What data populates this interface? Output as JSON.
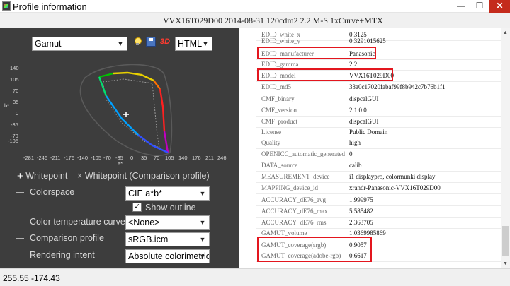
{
  "window": {
    "title": "Profile information",
    "minimize": "—",
    "maximize": "☐",
    "close": "✕"
  },
  "header": {
    "profile_title": "VVX16T029D00 2014-08-31 120cdm2 2.2 M-S 1xCurve+MTX"
  },
  "toolbar": {
    "view_select": "Gamut",
    "format_select": "HTML",
    "threed_label": "3D"
  },
  "plot": {
    "y_axis_label": "b*",
    "x_axis_label": "a*",
    "y_ticks": [
      "140",
      "105",
      "70",
      "35",
      "0",
      "-35",
      "-70",
      "-105"
    ],
    "x_ticks": [
      "-281",
      "-246",
      "-211",
      "-176",
      "-140",
      "-105",
      "-70",
      "-35",
      "0",
      "35",
      "70",
      "105",
      "140",
      "176",
      "211",
      "246"
    ]
  },
  "legend": {
    "plus_glyph": "+",
    "whitepoint": "Whitepoint",
    "x_glyph": "×",
    "whitepoint_comparison": "Whitepoint (Comparison profile)"
  },
  "settings": {
    "colorspace_label": "Colorspace",
    "colorspace_value": "CIE a*b*",
    "show_outline_label": "Show outline",
    "show_outline_checked": true,
    "check_mark": "✓",
    "color_temp_label": "Color temperature curve",
    "color_temp_value": "<None>",
    "comparison_label": "Comparison profile",
    "comparison_value": "sRGB.icm",
    "intent_label": "Rendering intent",
    "intent_value": "Absolute colorimetric"
  },
  "table": {
    "rows": [
      {
        "key": "EDID_white_x",
        "value": "0.3125"
      },
      {
        "key": "EDID_white_y",
        "value": "0.3291015625"
      },
      {
        "key": "EDID_manufacturer",
        "value": "Panasonic"
      },
      {
        "key": "EDID_gamma",
        "value": "2.2"
      },
      {
        "key": "EDID_model",
        "value": "VVX16T029D00"
      },
      {
        "key": "EDID_md5",
        "value": "33a0c17020fabaf99f8b942c7b76b1f1"
      },
      {
        "key": "CMF_binary",
        "value": "dispcalGUI"
      },
      {
        "key": "CMF_version",
        "value": "2.1.0.0"
      },
      {
        "key": "CMF_product",
        "value": "dispcalGUI"
      },
      {
        "key": "License",
        "value": "Public Domain"
      },
      {
        "key": "Quality",
        "value": "high"
      },
      {
        "key": "OPENICC_automatic_generated",
        "value": "0"
      },
      {
        "key": "DATA_source",
        "value": "calib"
      },
      {
        "key": "MEASUREMENT_device",
        "value": "i1 displaypro, colormunki display"
      },
      {
        "key": "MAPPING_device_id",
        "value": "xrandr-Panasonic-VVX16T029D00"
      },
      {
        "key": "ACCURACY_dE76_avg",
        "value": "1.999975"
      },
      {
        "key": "ACCURACY_dE76_max",
        "value": "5.585482"
      },
      {
        "key": "ACCURACY_dE76_rms",
        "value": "2.363705"
      },
      {
        "key": "GAMUT_volume",
        "value": "1.0369985869"
      },
      {
        "key": "GAMUT_coverage(srgb)",
        "value": "0.9057"
      },
      {
        "key": "GAMUT_coverage(adobe-rgb)",
        "value": "0.6617"
      }
    ]
  },
  "status": {
    "coordinates": "255.55 -174.43"
  },
  "colors": {
    "panel_bg": "#3d3d3d",
    "highlight": "#e3161e",
    "close_button": "#c42b1c"
  },
  "icons": [
    "bulb-icon",
    "save-icon",
    "3d-icon",
    "chevron-down-icon",
    "scroll-up-icon",
    "scroll-down-icon"
  ]
}
